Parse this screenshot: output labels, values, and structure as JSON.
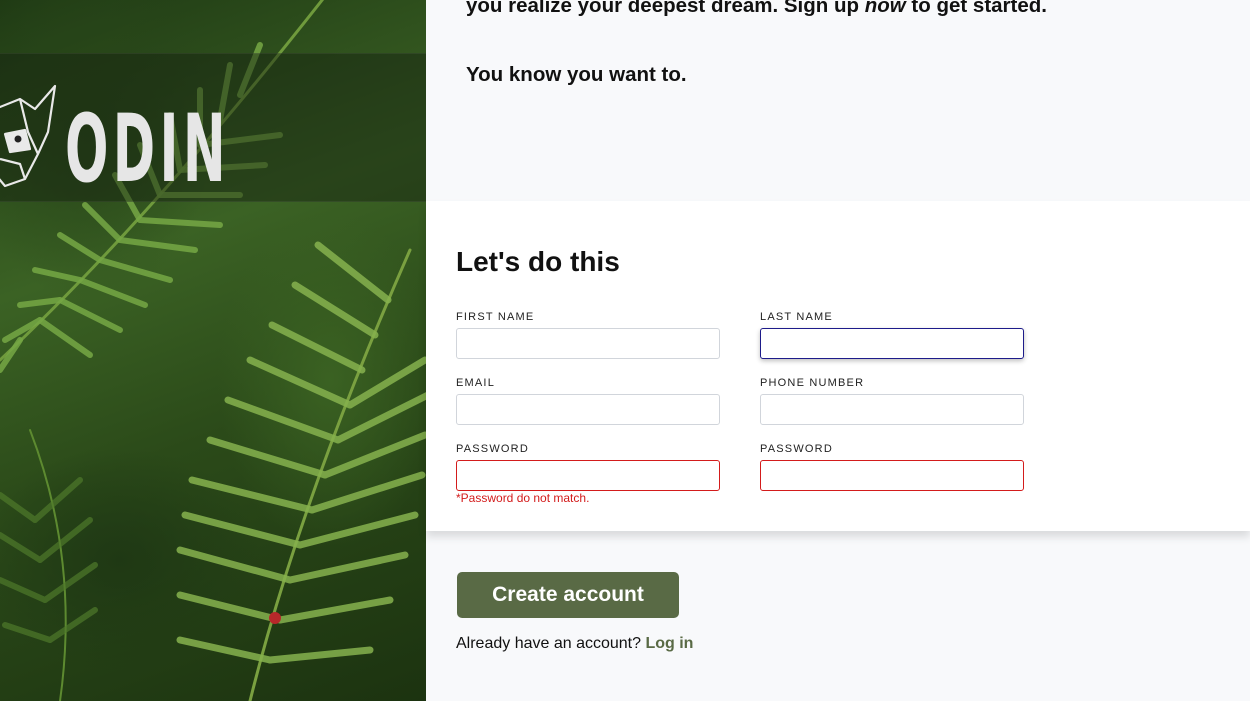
{
  "intro": {
    "line1_start": "you realize your deepest dream. Sign up ",
    "line1_em": "now",
    "line1_end": " to get started.",
    "line2": "You know you want to."
  },
  "brand": {
    "logo_text": "ODIN",
    "logo_icon": "odin-viking-head-icon"
  },
  "form": {
    "heading": "Let's do this",
    "fields": {
      "first_name": {
        "label": "FIRST NAME",
        "value": ""
      },
      "last_name": {
        "label": "LAST NAME",
        "value": ""
      },
      "email": {
        "label": "EMAIL",
        "value": ""
      },
      "phone": {
        "label": "PHONE NUMBER",
        "value": ""
      },
      "password": {
        "label": "PASSWORD",
        "value": ""
      },
      "password_confirm": {
        "label": "PASSWORD",
        "value": ""
      }
    },
    "error": "*Password do not match."
  },
  "cta": {
    "create_label": "Create account",
    "login_prompt": "Already have an account? ",
    "login_link": "Log in"
  },
  "colors": {
    "accent": "#596a45",
    "error": "#d31b1b",
    "focus": "#1d1b8a",
    "background": "#f8f9fb"
  }
}
